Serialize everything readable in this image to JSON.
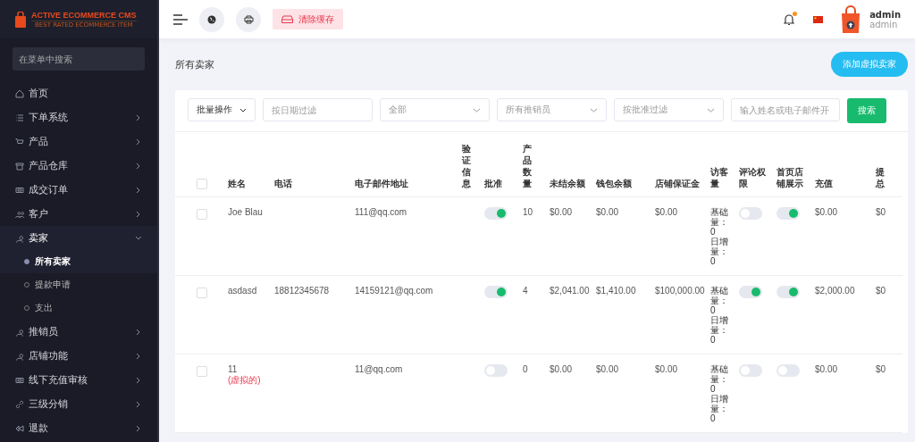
{
  "brand": {
    "title": "ACTIVE ECOMMERCE CMS",
    "tagline": "BEST RATED ECOMMERCE ITEM"
  },
  "sidebar": {
    "search": {
      "placeholder": "在菜单中搜索"
    },
    "items": [
      {
        "label": "首页",
        "selected": false
      },
      {
        "label": "下单系统",
        "selected": false,
        "expanded": false
      },
      {
        "label": "产品",
        "selected": false,
        "expanded": false
      },
      {
        "label": "产品仓库",
        "selected": false,
        "expanded": false
      },
      {
        "label": "成交订单",
        "selected": false,
        "expanded": false
      },
      {
        "label": "客户",
        "selected": false,
        "expanded": false
      },
      {
        "label": "卖家",
        "selected": true,
        "expanded": true,
        "children": [
          {
            "label": "所有卖家",
            "selected": true
          },
          {
            "label": "提款申请",
            "selected": false
          },
          {
            "label": "支出",
            "selected": false
          }
        ]
      },
      {
        "label": "推销员",
        "selected": false,
        "expanded": false
      },
      {
        "label": "店铺功能",
        "selected": false,
        "expanded": false
      },
      {
        "label": "线下充值审核",
        "selected": false,
        "expanded": false
      },
      {
        "label": "三级分销",
        "selected": false,
        "expanded": false
      },
      {
        "label": "退款",
        "selected": false,
        "expanded": false
      }
    ]
  },
  "topbar": {
    "clear_cache": "清除缓存",
    "notification_dot": true,
    "user": {
      "name": "admin",
      "role": "admin"
    }
  },
  "page": {
    "title": "所有卖家",
    "add_button": "添加虚拟卖家"
  },
  "filters": {
    "bulk": "批量操作",
    "date": {
      "placeholder": "按日期过滤"
    },
    "status": "全部",
    "salesman": "所有推销员",
    "approval": "按批准过滤",
    "search": {
      "placeholder": "输入姓名或电子邮件开"
    },
    "search_button": "搜索"
  },
  "table": {
    "all_checked": false,
    "columns": [
      "姓名",
      "电话",
      "电子邮件地址",
      "验证信息",
      "批准",
      "产品数量",
      "未结余额",
      "钱包余额",
      "店铺保证金",
      "访客量",
      "评论权限",
      "首页店铺展示",
      "充值",
      "提总"
    ],
    "rows": [
      {
        "checked": false,
        "name": "Joe Blau",
        "phone": "",
        "email": "111@qq.com",
        "approved": true,
        "products": "10",
        "unsettled": "$0.00",
        "wallet": "$0.00",
        "deposit": "$0.00",
        "visitors": [
          "基础量：0",
          "日增量：0"
        ],
        "comment": false,
        "homepage": true,
        "recharge": "$0.00",
        "withdraw": "$0"
      },
      {
        "checked": false,
        "name": "asdasd",
        "phone": "18812345678",
        "email": "14159121@qq.com",
        "approved": true,
        "products": "4",
        "unsettled": "$2,041.00",
        "wallet": "$1,410.00",
        "deposit": "$100,000.00",
        "visitors": [
          "基础量：0",
          "日增量：0"
        ],
        "comment": true,
        "homepage": true,
        "recharge": "$2,000.00",
        "withdraw": "$0"
      },
      {
        "checked": false,
        "name": "11",
        "virtual_label": "(虚拟的)",
        "phone": "",
        "email": "11@qq.com",
        "approved": false,
        "products": "0",
        "unsettled": "$0.00",
        "wallet": "$0.00",
        "deposit": "$0.00",
        "visitors": [
          "基础量：0",
          "日增量：0"
        ],
        "comment": false,
        "homepage": false,
        "recharge": "$0.00",
        "withdraw": "$0"
      }
    ]
  }
}
